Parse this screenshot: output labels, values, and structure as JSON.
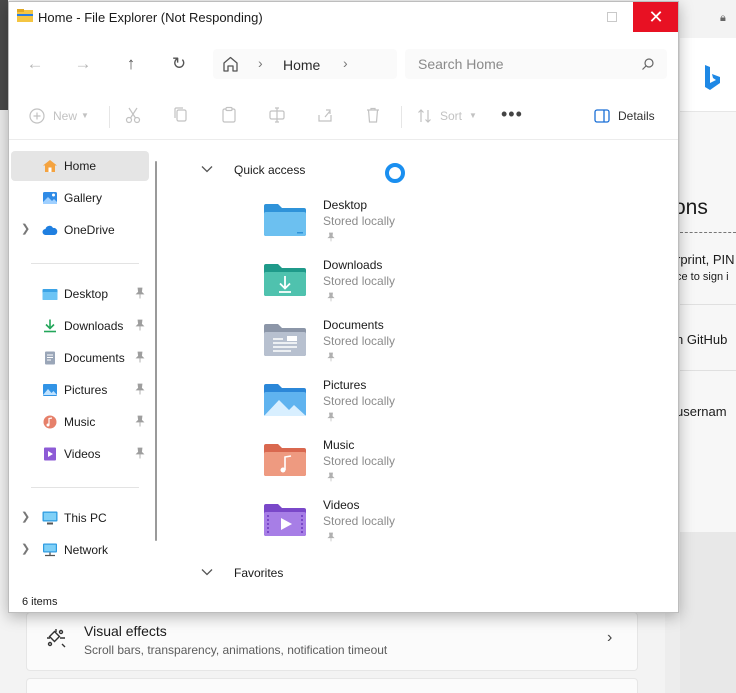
{
  "window": {
    "title": "Home - File Explorer (Not Responding)",
    "close_glyph": "✕"
  },
  "nav": {
    "back_glyph": "←",
    "forward_glyph": "→",
    "up_glyph": "↑",
    "refresh_glyph": "↻",
    "breadcrumb": "Home",
    "chevron_glyph": "›",
    "search_placeholder": "Search Home"
  },
  "toolbar": {
    "new_label": "New",
    "sort_label": "Sort",
    "more_glyph": "•••",
    "details_label": "Details"
  },
  "sidebar": {
    "items": [
      {
        "label": "Home",
        "icon": "home-icon",
        "active": true
      },
      {
        "label": "Gallery",
        "icon": "gallery-icon"
      },
      {
        "label": "OneDrive",
        "icon": "cloud-icon",
        "expandable": true
      },
      {
        "label": "Desktop",
        "icon": "desktop-folder-icon",
        "pinned": true
      },
      {
        "label": "Downloads",
        "icon": "download-icon",
        "pinned": true
      },
      {
        "label": "Documents",
        "icon": "documents-icon",
        "pinned": true
      },
      {
        "label": "Pictures",
        "icon": "pictures-icon",
        "pinned": true
      },
      {
        "label": "Music",
        "icon": "music-icon",
        "pinned": true
      },
      {
        "label": "Videos",
        "icon": "videos-icon",
        "pinned": true
      },
      {
        "label": "This PC",
        "icon": "pc-icon",
        "expandable": true
      },
      {
        "label": "Network",
        "icon": "network-icon",
        "expandable": true
      }
    ]
  },
  "content": {
    "quick_access_title": "Quick access",
    "favorites_title": "Favorites",
    "folders": [
      {
        "name": "Desktop",
        "status": "Stored locally",
        "icon": "desktop-folder-icon"
      },
      {
        "name": "Downloads",
        "status": "Stored locally",
        "icon": "downloads-folder-icon"
      },
      {
        "name": "Documents",
        "status": "Stored locally",
        "icon": "documents-folder-icon"
      },
      {
        "name": "Pictures",
        "status": "Stored locally",
        "icon": "pictures-folder-icon"
      },
      {
        "name": "Music",
        "status": "Stored locally",
        "icon": "music-folder-icon"
      },
      {
        "name": "Videos",
        "status": "Stored locally",
        "icon": "videos-folder-icon"
      }
    ]
  },
  "status": {
    "items_count": "6 items"
  },
  "background": {
    "browser_fragments": {
      "logo_text": "b",
      "heading": "ons",
      "line1": "rprint, PIN",
      "line2": "ce to sign i",
      "line3": "n GitHub",
      "line4": "usernam"
    },
    "settings_card": {
      "title": "Visual effects",
      "subtitle": "Scroll bars, transparency, animations, notification timeout",
      "chevron_glyph": "›"
    }
  },
  "colors": {
    "accent": "#1a8ff0",
    "close_red": "#e81123",
    "bing_blue": "#1e88e5"
  }
}
